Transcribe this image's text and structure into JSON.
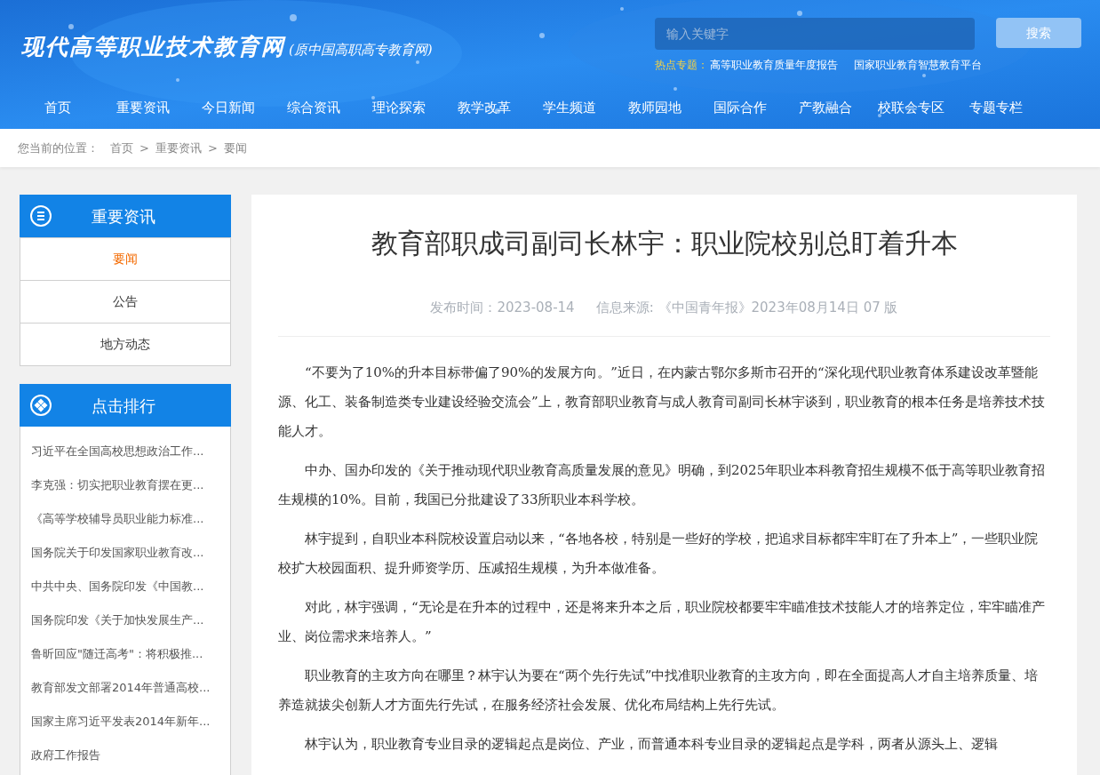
{
  "header": {
    "logo_title": "现代高等职业技术教育网",
    "logo_subtitle": "(原中国高职高专教育网)",
    "search": {
      "placeholder": "输入关键字",
      "button": "搜索"
    },
    "hot_topics": {
      "label": "热点专题：",
      "links": [
        "高等职业教育质量年度报告",
        "国家职业教育智慧教育平台"
      ]
    }
  },
  "nav": [
    {
      "label": "首页"
    },
    {
      "label": "重要资讯"
    },
    {
      "label": "今日新闻"
    },
    {
      "label": "综合资讯"
    },
    {
      "label": "理论探索"
    },
    {
      "label": "教学改革"
    },
    {
      "label": "学生频道"
    },
    {
      "label": "教师园地"
    },
    {
      "label": "国际合作"
    },
    {
      "label": "产教融合"
    },
    {
      "label": "校联会专区"
    },
    {
      "label": "专题专栏"
    }
  ],
  "breadcrumb": {
    "label": "您当前的位置：",
    "items": [
      "首页",
      "重要资讯",
      "要闻"
    ],
    "separator": ">"
  },
  "sidebar": {
    "category": {
      "title": "重要资讯",
      "items": [
        {
          "label": "要闻",
          "selected": true
        },
        {
          "label": "公告",
          "selected": false
        },
        {
          "label": "地方动态",
          "selected": false
        }
      ]
    },
    "ranking": {
      "title": "点击排行",
      "items": [
        "习近平在全国高校思想政治工作...",
        "李克强：切实把职业教育摆在更...",
        "《高等学校辅导员职业能力标准...",
        "国务院关于印发国家职业教育改...",
        "中共中央、国务院印发《中国教...",
        "国务院印发《关于加快发展生产...",
        "鲁昕回应\"随迁高考\"：将积极推...",
        "教育部发文部署2014年普通高校...",
        "国家主席习近平发表2014年新年...",
        "政府工作报告"
      ]
    }
  },
  "article": {
    "title": "教育部职成司副司长林宇：职业院校别总盯着升本",
    "publish_label": "发布时间：",
    "publish_date": "2023-08-14",
    "source_label": "信息来源:",
    "source": "《中国青年报》2023年08月14日 07 版",
    "paragraphs": [
      "“不要为了10%的升本目标带偏了90%的发展方向。”近日，在内蒙古鄂尔多斯市召开的“深化现代职业教育体系建设改革暨能源、化工、装备制造类专业建设经验交流会”上，教育部职业教育与成人教育司副司长林宇谈到，职业教育的根本任务是培养技术技能人才。",
      "中办、国办印发的《关于推动现代职业教育高质量发展的意见》明确，到2025年职业本科教育招生规模不低于高等职业教育招生规模的10%。目前，我国已分批建设了33所职业本科学校。",
      "林宇提到，自职业本科院校设置启动以来，“各地各校，特别是一些好的学校，把追求目标都牢牢盯在了升本上”，一些职业院校扩大校园面积、提升师资学历、压减招生规模，为升本做准备。",
      "对此，林宇强调，“无论是在升本的过程中，还是将来升本之后，职业院校都要牢牢瞄准技术技能人才的培养定位，牢牢瞄准产业、岗位需求来培养人。”",
      "职业教育的主攻方向在哪里？林宇认为要在“两个先行先试”中找准职业教育的主攻方向，即在全面提高人才自主培养质量、培养造就拔尖创新人才方面先行先试，在服务经济社会发展、优化布局结构上先行先试。",
      "林宇认为，职业教育专业目录的逻辑起点是岗位、产业，而普通本科专业目录的逻辑起点是学科，两者从源头上、逻辑"
    ]
  }
}
